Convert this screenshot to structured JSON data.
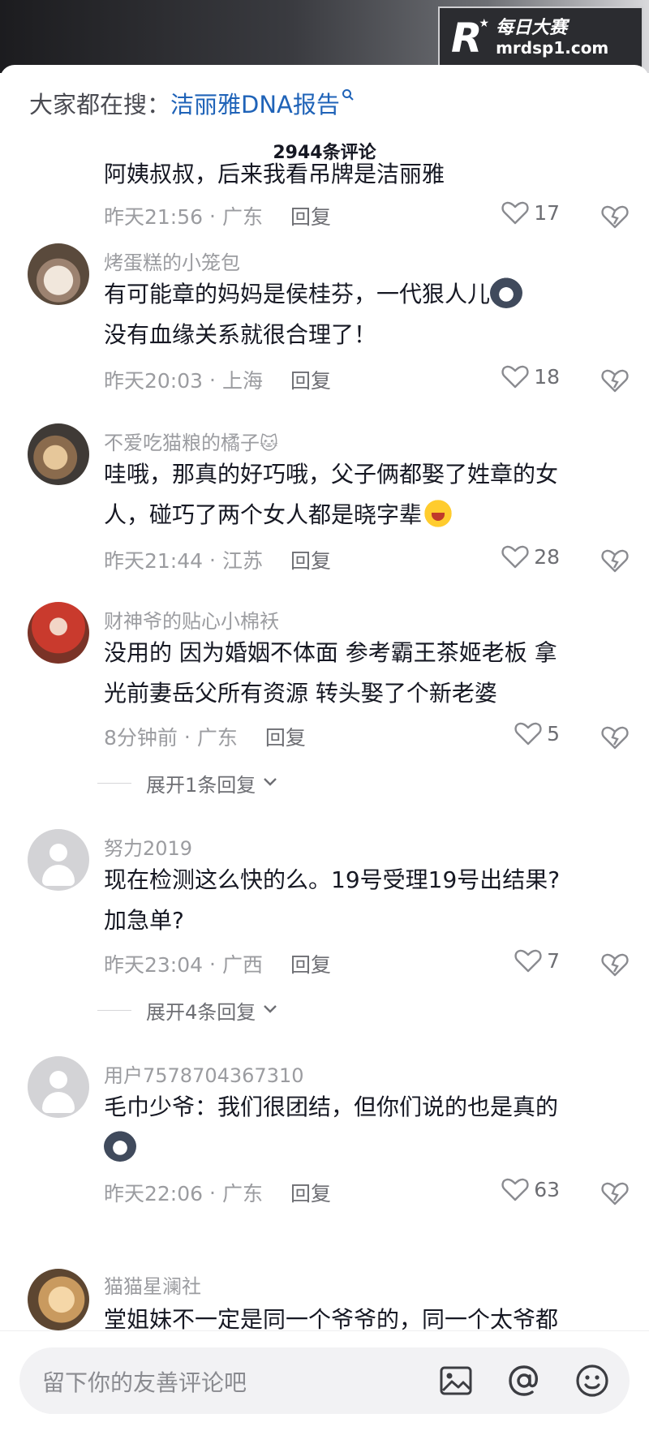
{
  "watermark": {
    "logo": "R",
    "star": "★",
    "cn": "每日大赛",
    "url": "mrdsp1.com"
  },
  "search_hint": {
    "label": "大家都在搜：",
    "term": "洁丽雅DNA报告"
  },
  "comments_title": "2944条评论",
  "comments": [
    {
      "text_lines": [
        "阿姨叔叔，后来我看吊牌是洁丽雅"
      ],
      "time": "昨天21:56",
      "location": "广东",
      "reply": "回复",
      "likes": "17"
    },
    {
      "username": "烤蛋糕的小笼包",
      "text_lines": [
        "有可能章的妈妈是侯桂芬，一代狠人儿",
        "没有血缘关系就很合理了！"
      ],
      "time": "昨天20:03",
      "location": "上海",
      "reply": "回复",
      "likes": "18"
    },
    {
      "username": "不爱吃猫粮的橘子",
      "text_lines": [
        "哇哦，那真的好巧哦，父子俩都娶了姓章的女",
        "人，碰巧了两个女人都是晓字辈"
      ],
      "time": "昨天21:44",
      "location": "江苏",
      "reply": "回复",
      "likes": "28"
    },
    {
      "username": "财神爷的贴心小棉袄",
      "text_lines": [
        "没用的 因为婚姻不体面 参考霸王茶姬老板 拿",
        "光前妻岳父所有资源 转头娶了个新老婆"
      ],
      "time": "8分钟前",
      "location": "广东",
      "reply": "回复",
      "likes": "5",
      "expand": "展开1条回复"
    },
    {
      "username": "努力2019",
      "text_lines": [
        "现在检测这么快的么。19号受理19号出结果?",
        "加急单?"
      ],
      "time": "昨天23:04",
      "location": "广西",
      "reply": "回复",
      "likes": "7",
      "expand": "展开4条回复"
    },
    {
      "username": "用户7578704367310",
      "text_lines": [
        "毛巾少爷：我们很团结，但你们说的也是真的"
      ],
      "time": "昨天22:06",
      "location": "广东",
      "reply": "回复",
      "likes": "63"
    },
    {
      "username": "猫猫星澜社",
      "text_lines": [
        "堂姐妹不一定是同一个爷爷的，同一个太爷都"
      ]
    }
  ],
  "input": {
    "placeholder": "留下你的友善评论吧"
  },
  "colors": {
    "link": "#1f63b8",
    "muted": "#9b9ca0",
    "text": "#161823"
  }
}
